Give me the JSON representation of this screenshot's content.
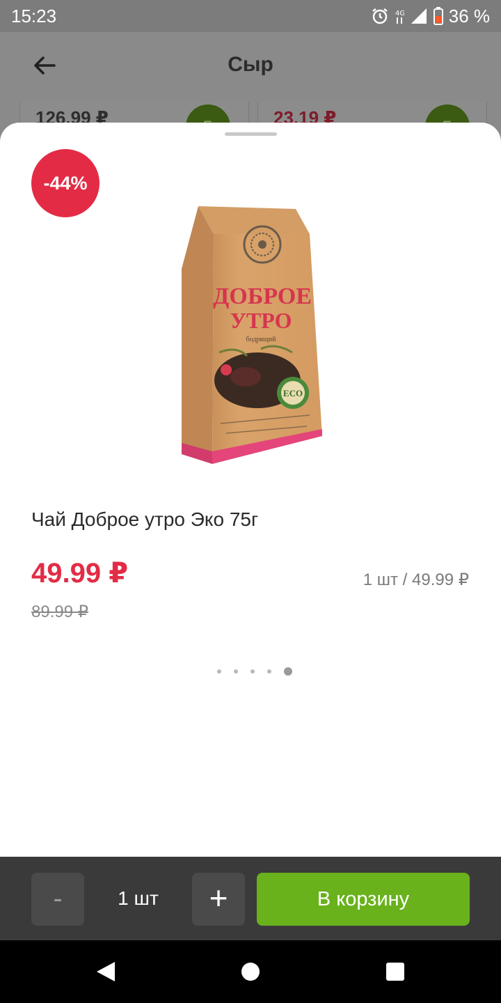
{
  "status_bar": {
    "time": "15:23",
    "battery": "36 %",
    "icons": [
      "alarm-icon",
      "network-4g-icon",
      "signal-icon",
      "battery-icon"
    ]
  },
  "background_page": {
    "title": "Сыр",
    "cards": [
      {
        "price": "126.99 ₽",
        "add_label": "Б"
      },
      {
        "price": "23.19 ₽",
        "add_label": "Б"
      }
    ]
  },
  "product": {
    "discount": "-44%",
    "title": "Чай Доброе утро Эко 75г",
    "price_current": "49.99 ₽",
    "price_old": "89.99 ₽",
    "unit_price": "1 шт / 49.99 ₽",
    "image_pages": 5,
    "active_image_page": 5,
    "package": {
      "brand_line1": "ДОБРОЕ",
      "brand_line2": "УТРО",
      "subtitle": "бодрящий",
      "eco": "ECO"
    }
  },
  "actions": {
    "minus": "-",
    "plus": "+",
    "quantity": "1 шт",
    "add_to_cart": "В корзину"
  },
  "colors": {
    "accent_red": "#e32b45",
    "accent_green": "#69b21c",
    "action_bar": "#3a3a3a"
  }
}
